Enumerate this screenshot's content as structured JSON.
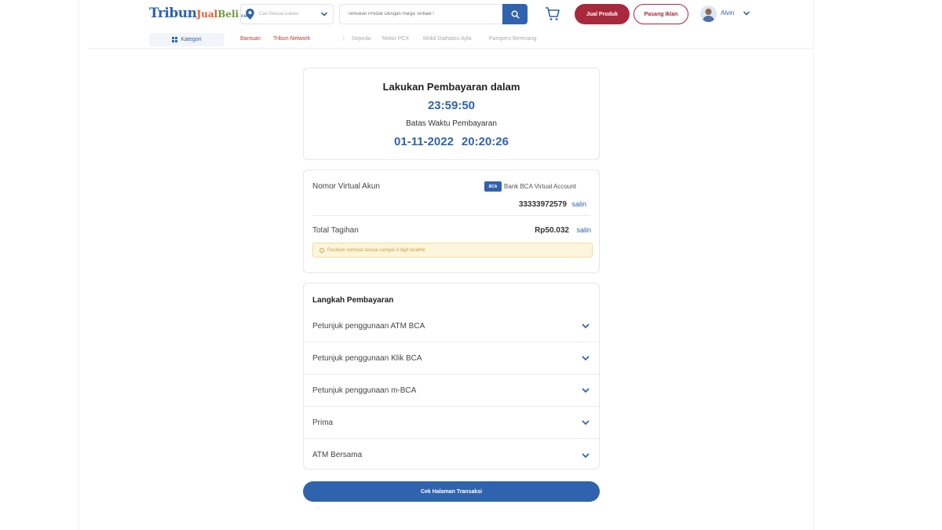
{
  "header": {
    "logo": {
      "part1": "Tribun",
      "part2": "Jual",
      "part3": "Beli",
      "part4": ".com"
    },
    "location": {
      "placeholder": "Cari Sesuai Lokasi",
      "icon": "map-pin-icon"
    },
    "search": {
      "placeholder": "Temukan Produk Dengan Harga Terbaik !",
      "icon": "search-icon"
    },
    "cart_icon": "cart-icon",
    "sell_button": "Jual Produk",
    "ad_button": "Pasang Iklan",
    "user": {
      "name": "Alvin"
    }
  },
  "subnav": {
    "category": "Kategori",
    "links_red": [
      "Bantuan",
      "Tribun Network"
    ],
    "separator": "|",
    "links_gray": [
      "Sepeda",
      "Motor PCX",
      "Mobil Daihatsu Ayla",
      "Pampers Berenang"
    ]
  },
  "payment": {
    "title": "Lakukan Pembayaran dalam",
    "countdown": "23:59:50",
    "deadline_label": "Batas Waktu Pembayaran",
    "deadline_date": "01-11-2022",
    "deadline_time": "20:20:26"
  },
  "virtual_account": {
    "label": "Nomor Virtual Akun",
    "bank_logo_text": "BCA",
    "bank_name": "Bank BCA Virtual Account",
    "number": "33333972579",
    "copy_label": "salin",
    "total_label": "Total Tagihan",
    "total_value": "Rp50.032",
    "notice": "Pastikan nominal sesuai sampai 3 digit terakhir"
  },
  "steps": {
    "title": "Langkah Pembayaran",
    "items": [
      "Petunjuk penggunaan ATM BCA",
      "Petunjuk penggunaan Klik BCA",
      "Petunjuk penggunaan m-BCA",
      "Prima",
      "ATM Bersama"
    ]
  },
  "cta": "Cek Halaman Transaksi",
  "colors": {
    "primary": "#2f63ad",
    "brand_red": "#a8283c",
    "notice_bg": "#fdf5dc"
  }
}
